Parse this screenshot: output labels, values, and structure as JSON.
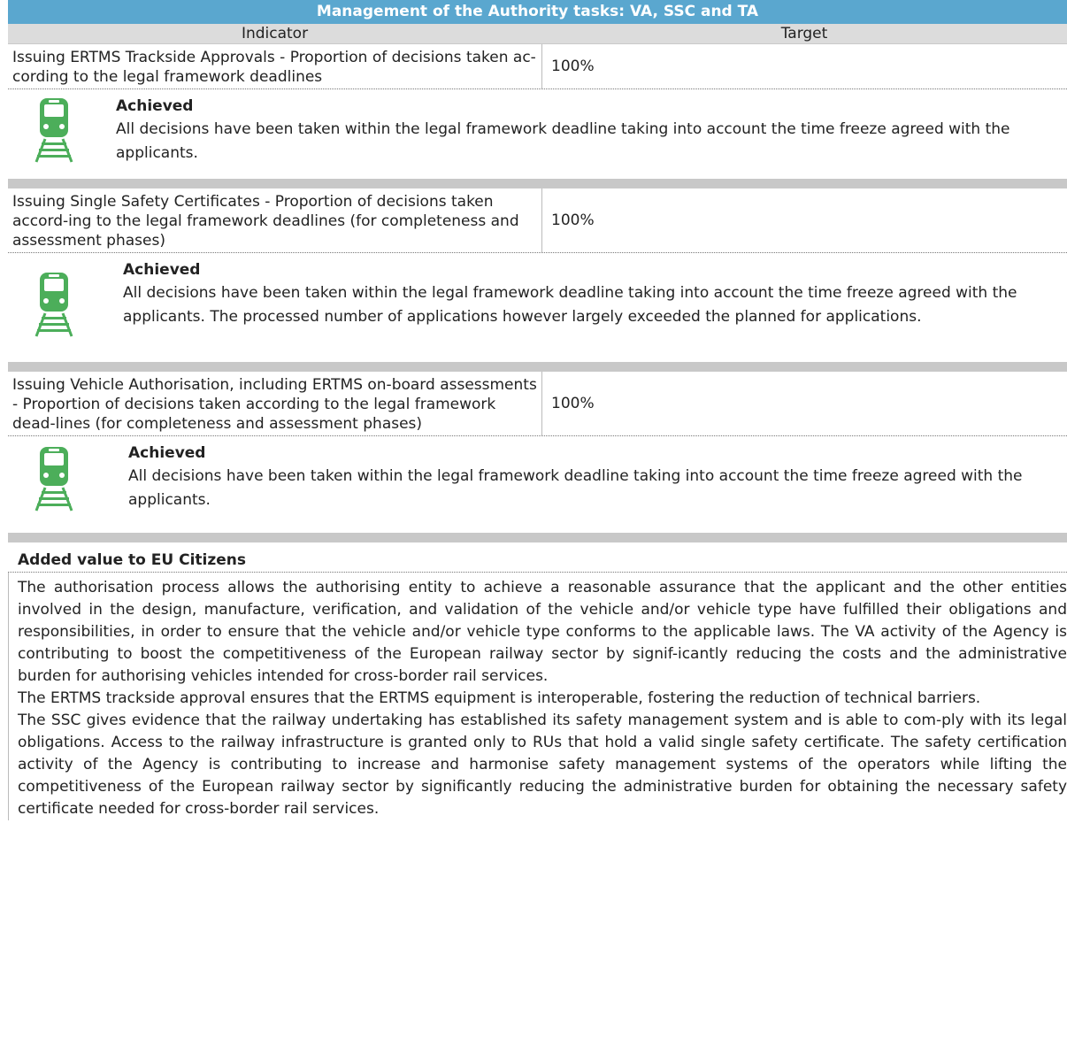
{
  "title": "Management of the Authority tasks: VA, SSC and TA",
  "columns": {
    "indicator": "Indicator",
    "target": "Target"
  },
  "rows": [
    {
      "indicator": "Issuing ERTMS Trackside Approvals - Proportion of decisions taken ac-cording to the legal framework deadlines",
      "target": "100%",
      "status": "Achieved",
      "description": "All decisions have been taken within the legal framework deadline taking into account the time freeze agreed with the applicants.",
      "icon": "train-icon"
    },
    {
      "indicator": "Issuing Single Safety Certificates - Proportion of decisions taken accord-ing to the legal framework deadlines (for completeness and assessment phases)",
      "target": "100%",
      "status": "Achieved",
      "description": "All decisions have been taken within the legal framework deadline taking into account the time freeze agreed with the applicants. The processed number of applications however largely exceeded the planned for applications.",
      "icon": "train-icon"
    },
    {
      "indicator": "Issuing Vehicle Authorisation, including ERTMS on-board assessments - Proportion of decisions taken according to the legal framework dead-lines (for completeness and assessment phases)",
      "target": "100%",
      "status": "Achieved",
      "description": "All decisions have been taken within the legal framework deadline taking into account the time freeze agreed with the applicants.",
      "icon": "train-icon"
    }
  ],
  "added_value": {
    "heading": "Added value to EU Citizens",
    "paragraphs": [
      "The authorisation process allows the authorising entity to achieve a reasonable assurance that the applicant and the other entities involved in the design, manufacture, verification, and validation of the vehicle and/or vehicle type have fulfilled their obligations and responsibilities, in order to ensure that the vehicle and/or vehicle type conforms to the applicable laws. The VA activity of the Agency is contributing to boost the competitiveness of the European railway sector by signif-icantly reducing the costs and the administrative burden for authorising vehicles intended for cross-border rail services.",
      "The ERTMS trackside approval ensures that the ERTMS equipment is interoperable, fostering the reduction of technical barriers.",
      "The SSC gives evidence that the railway undertaking has established its safety management system and is able to com-ply with its legal obligations. Access to the railway infrastructure is granted only to RUs that hold a valid single safety certificate. The safety certification activity of the Agency is contributing to increase and harmonise safety management systems of the operators while lifting the competitiveness of the European railway sector by significantly reducing the administrative burden for obtaining the necessary safety certificate needed for cross-border rail services."
    ]
  },
  "colors": {
    "header": "#5aa7cf",
    "icon": "#4cae5a",
    "separator": "#c8c8c8",
    "subheader": "#dcdcdc"
  }
}
